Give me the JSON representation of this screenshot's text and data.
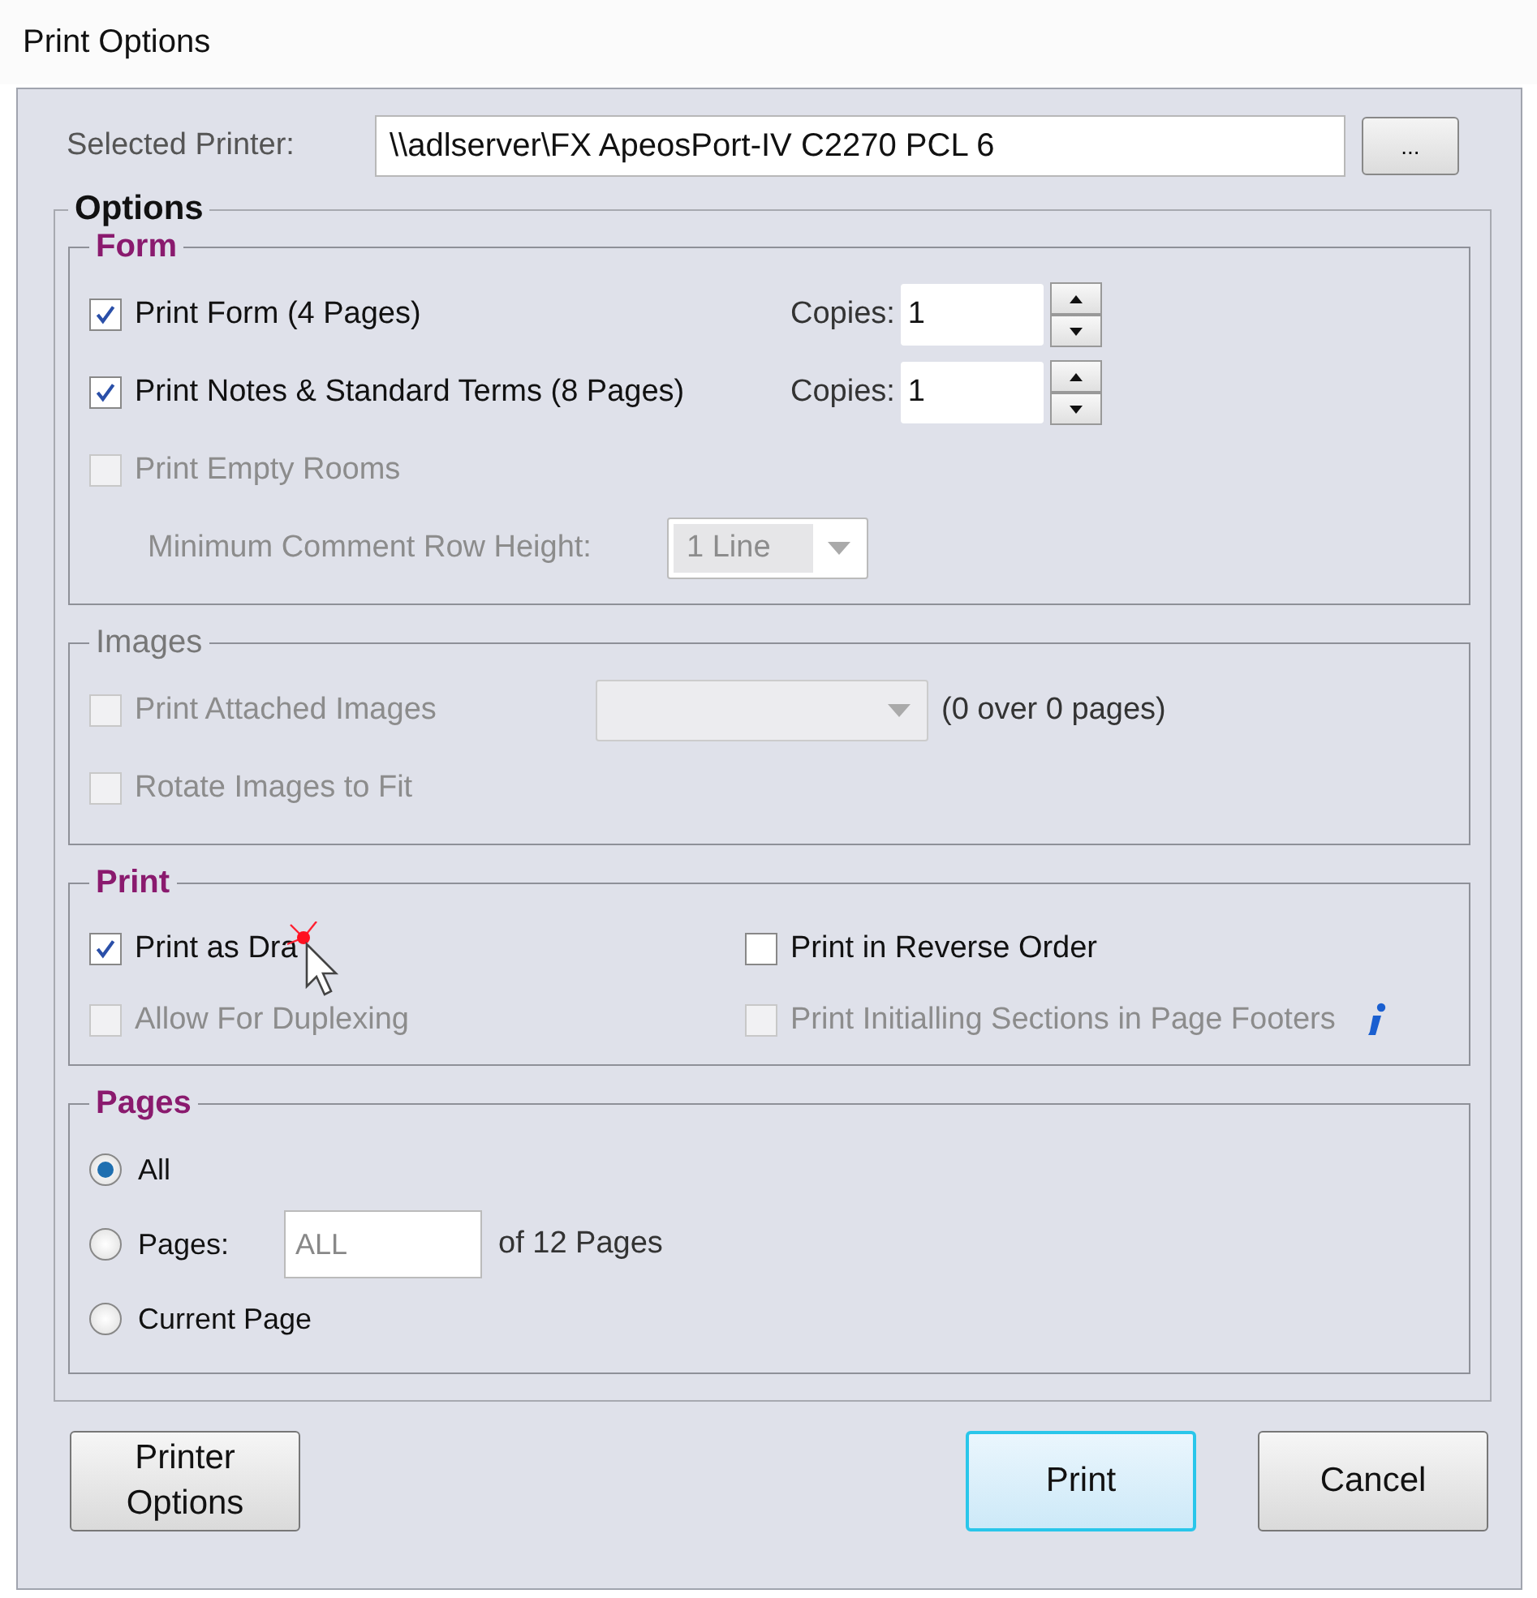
{
  "window": {
    "title": "Print Options"
  },
  "printer": {
    "label": "Selected Printer:",
    "value": "\\\\adlserver\\FX ApeosPort-IV C2270 PCL 6",
    "browse_button": "..."
  },
  "options_title": "Options",
  "form": {
    "title": "Form",
    "disabled": false,
    "items": [
      {
        "label": "Print Form (4 Pages)",
        "checked": true,
        "disabled": false,
        "copies_label": "Copies:",
        "copies": "1"
      },
      {
        "label": "Print Notes & Standard Terms (8 Pages)",
        "checked": true,
        "disabled": false,
        "copies_label": "Copies:",
        "copies": "1"
      },
      {
        "label": "Print Empty Rooms",
        "checked": false,
        "disabled": true
      }
    ],
    "row_height": {
      "label": "Minimum Comment Row Height:",
      "value": "1 Line",
      "disabled": true
    }
  },
  "images": {
    "title": "Images",
    "disabled": true,
    "items": [
      {
        "label": "Print Attached Images",
        "checked": false,
        "disabled": true,
        "note": "(0 over 0 pages)"
      },
      {
        "label": "Rotate Images to Fit",
        "checked": false,
        "disabled": true
      }
    ]
  },
  "print": {
    "title": "Print",
    "disabled": false,
    "left": [
      {
        "label": "Print as Dra",
        "checked": true,
        "disabled": false,
        "cursor": true
      },
      {
        "label": "Allow For Duplexing",
        "checked": false,
        "disabled": true
      }
    ],
    "right": [
      {
        "label": "Print in Reverse Order",
        "checked": false,
        "disabled": false
      },
      {
        "label": "Print Initialling Sections in Page Footers",
        "checked": false,
        "disabled": true,
        "info": true
      }
    ]
  },
  "pages": {
    "title": "Pages",
    "disabled": false,
    "options": [
      {
        "label": "All",
        "selected": true,
        "kind": "plain"
      },
      {
        "label": "Pages:",
        "selected": false,
        "kind": "range",
        "placeholder": "ALL",
        "suffix": "of 12 Pages"
      },
      {
        "label": "Current Page",
        "selected": false,
        "kind": "plain"
      }
    ]
  },
  "buttons": [
    {
      "label": "Printer Options",
      "kind": "left",
      "focused": false
    },
    {
      "label": "Print",
      "kind": "right",
      "focused": true
    },
    {
      "label": "Cancel",
      "kind": "right",
      "focused": false
    }
  ]
}
